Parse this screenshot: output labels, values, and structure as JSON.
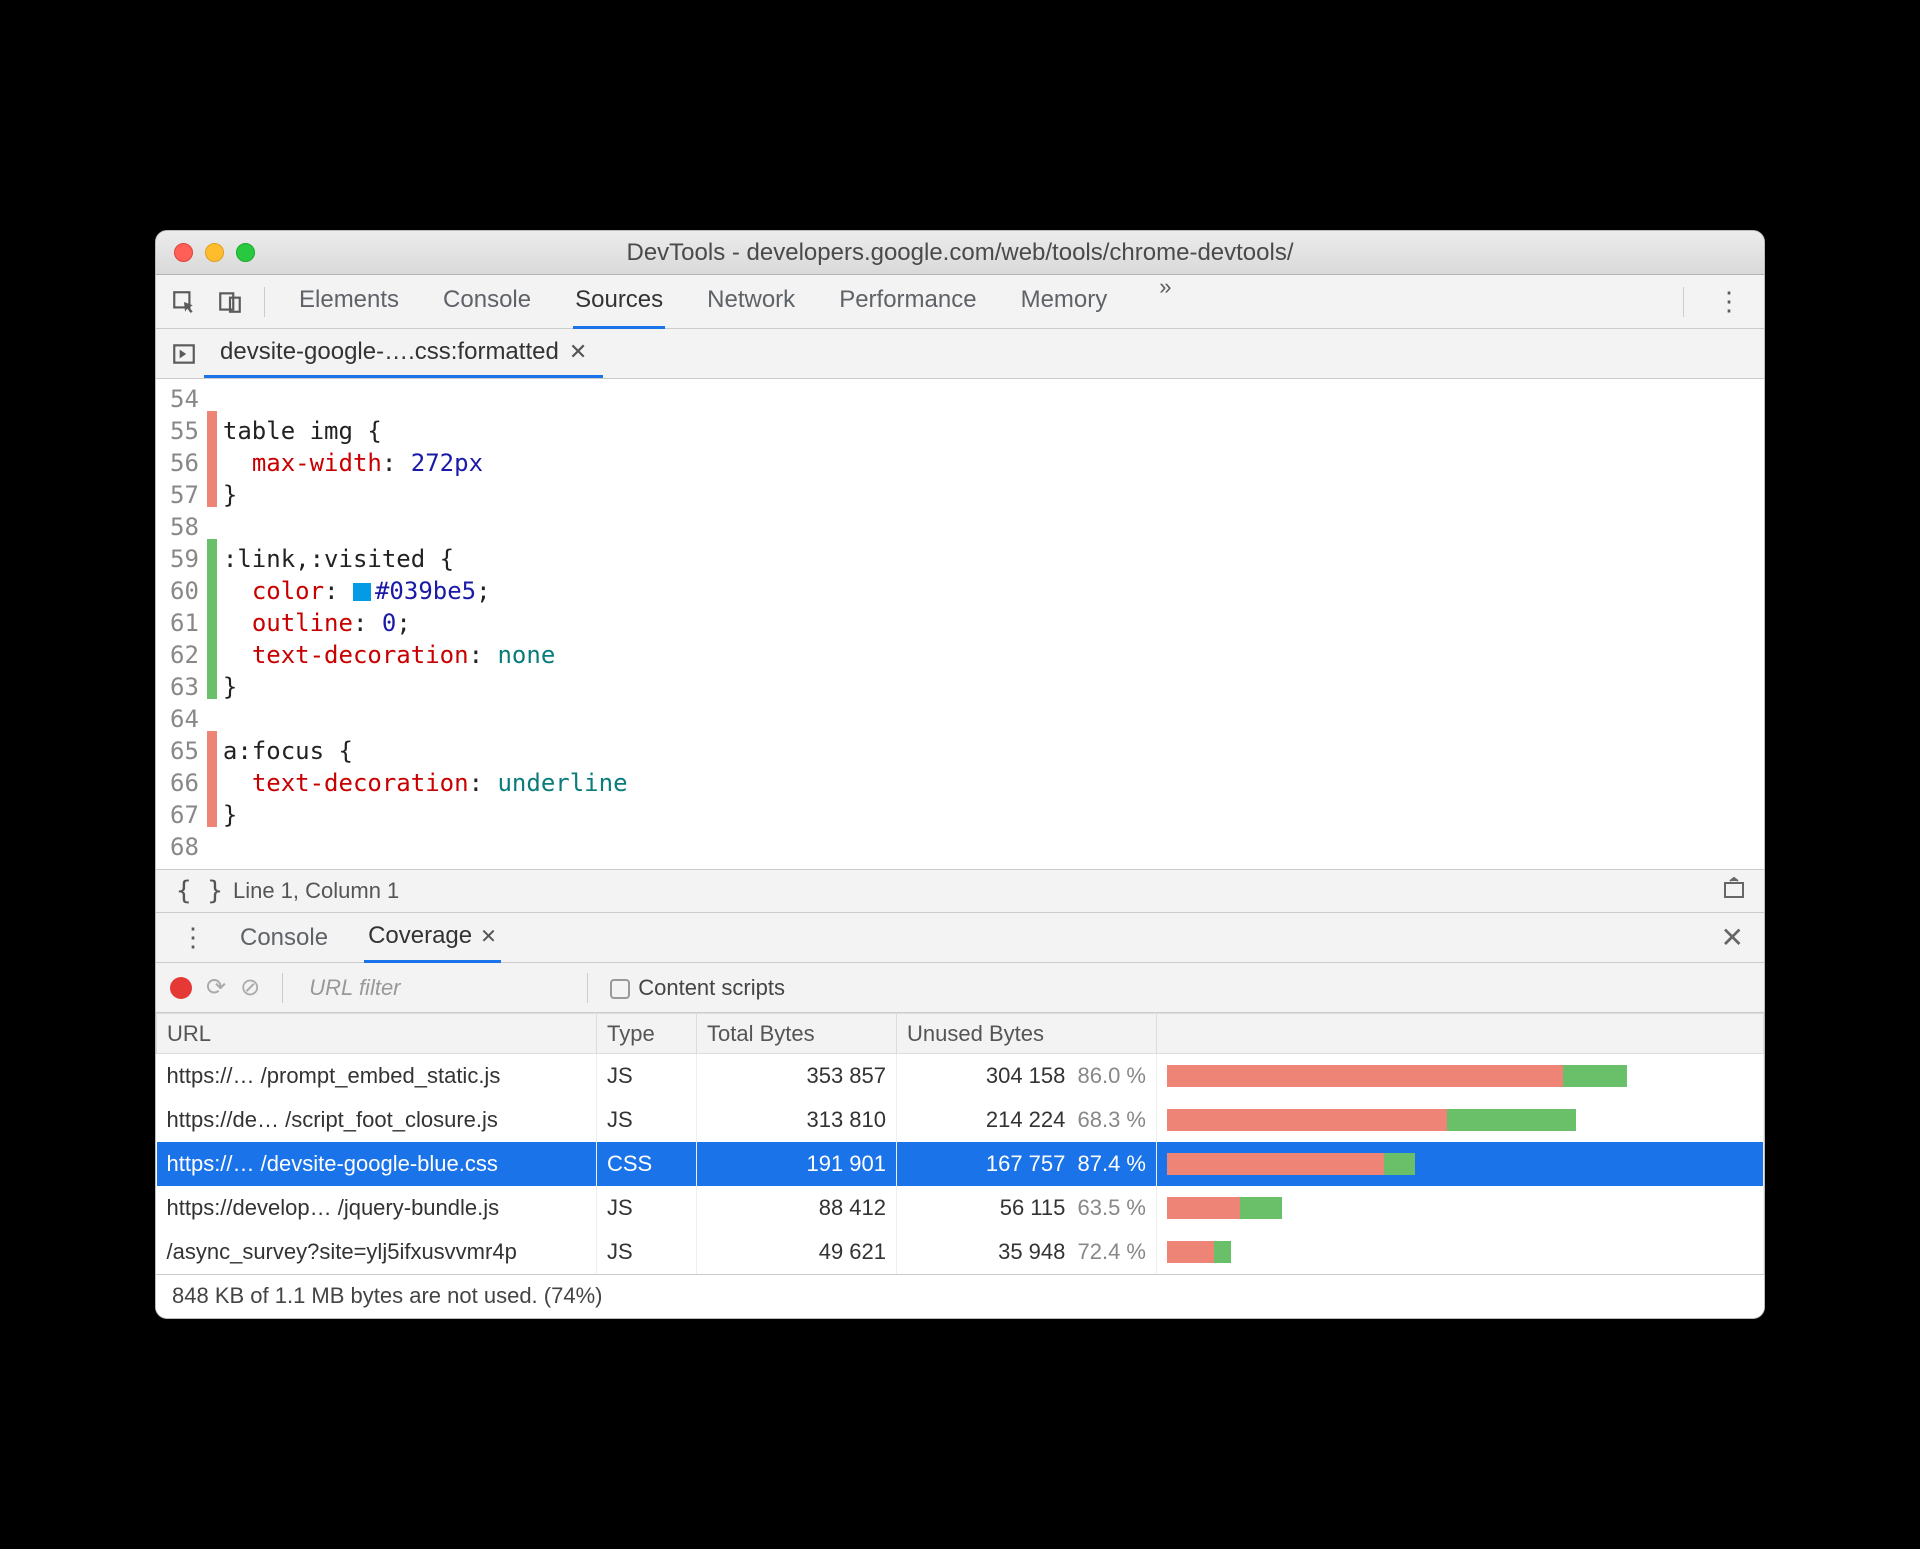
{
  "window": {
    "title": "DevTools - developers.google.com/web/tools/chrome-devtools/"
  },
  "main_tabs": {
    "items": [
      "Elements",
      "Console",
      "Sources",
      "Network",
      "Performance",
      "Memory"
    ],
    "active_index": 2
  },
  "file_tab": {
    "name": "devsite-google-….css:formatted"
  },
  "editor": {
    "lines": [
      {
        "num": "54",
        "cov": "",
        "text": ""
      },
      {
        "num": "55",
        "cov": "red",
        "selector": "table img {"
      },
      {
        "num": "56",
        "cov": "red",
        "prop": "max-width",
        "val": "272px"
      },
      {
        "num": "57",
        "cov": "red",
        "close": "}"
      },
      {
        "num": "58",
        "cov": "",
        "text": ""
      },
      {
        "num": "59",
        "cov": "green",
        "selector": ":link,:visited {"
      },
      {
        "num": "60",
        "cov": "green",
        "prop": "color",
        "color": "#039be5"
      },
      {
        "num": "61",
        "cov": "green",
        "prop": "outline",
        "val": "0",
        "nosemi": false
      },
      {
        "num": "62",
        "cov": "green",
        "prop": "text-decoration",
        "valkw": "none"
      },
      {
        "num": "63",
        "cov": "green",
        "close": "}"
      },
      {
        "num": "64",
        "cov": "",
        "text": ""
      },
      {
        "num": "65",
        "cov": "red",
        "selector": "a:focus {"
      },
      {
        "num": "66",
        "cov": "red",
        "prop": "text-decoration",
        "valkw": "underline"
      },
      {
        "num": "67",
        "cov": "red",
        "close": "}"
      },
      {
        "num": "68",
        "cov": "",
        "text": ""
      }
    ],
    "status": "Line 1, Column 1"
  },
  "drawer": {
    "tabs": [
      "Console",
      "Coverage"
    ],
    "active_index": 1
  },
  "coverage_toolbar": {
    "url_filter_placeholder": "URL filter",
    "content_scripts_label": "Content scripts"
  },
  "coverage_table": {
    "headers": [
      "URL",
      "Type",
      "Total Bytes",
      "Unused Bytes",
      ""
    ],
    "rows": [
      {
        "url": "https://… /prompt_embed_static.js",
        "type": "JS",
        "total": "353 857",
        "unused": "304 158",
        "pct": "86.0 %",
        "bar_pct": 86.0,
        "bar_scale": 1.0,
        "selected": false
      },
      {
        "url": "https://de… /script_foot_closure.js",
        "type": "JS",
        "total": "313 810",
        "unused": "214 224",
        "pct": "68.3 %",
        "bar_pct": 68.3,
        "bar_scale": 0.89,
        "selected": false
      },
      {
        "url": "https://… /devsite-google-blue.css",
        "type": "CSS",
        "total": "191 901",
        "unused": "167 757",
        "pct": "87.4 %",
        "bar_pct": 87.4,
        "bar_scale": 0.54,
        "selected": true
      },
      {
        "url": "https://develop… /jquery-bundle.js",
        "type": "JS",
        "total": "88 412",
        "unused": "56 115",
        "pct": "63.5 %",
        "bar_pct": 63.5,
        "bar_scale": 0.25,
        "selected": false
      },
      {
        "url": "/async_survey?site=ylj5ifxusvvmr4p",
        "type": "JS",
        "total": "49 621",
        "unused": "35 948",
        "pct": "72.4 %",
        "bar_pct": 72.4,
        "bar_scale": 0.14,
        "selected": false
      }
    ],
    "footer": "848 KB of 1.1 MB bytes are not used. (74%)"
  }
}
